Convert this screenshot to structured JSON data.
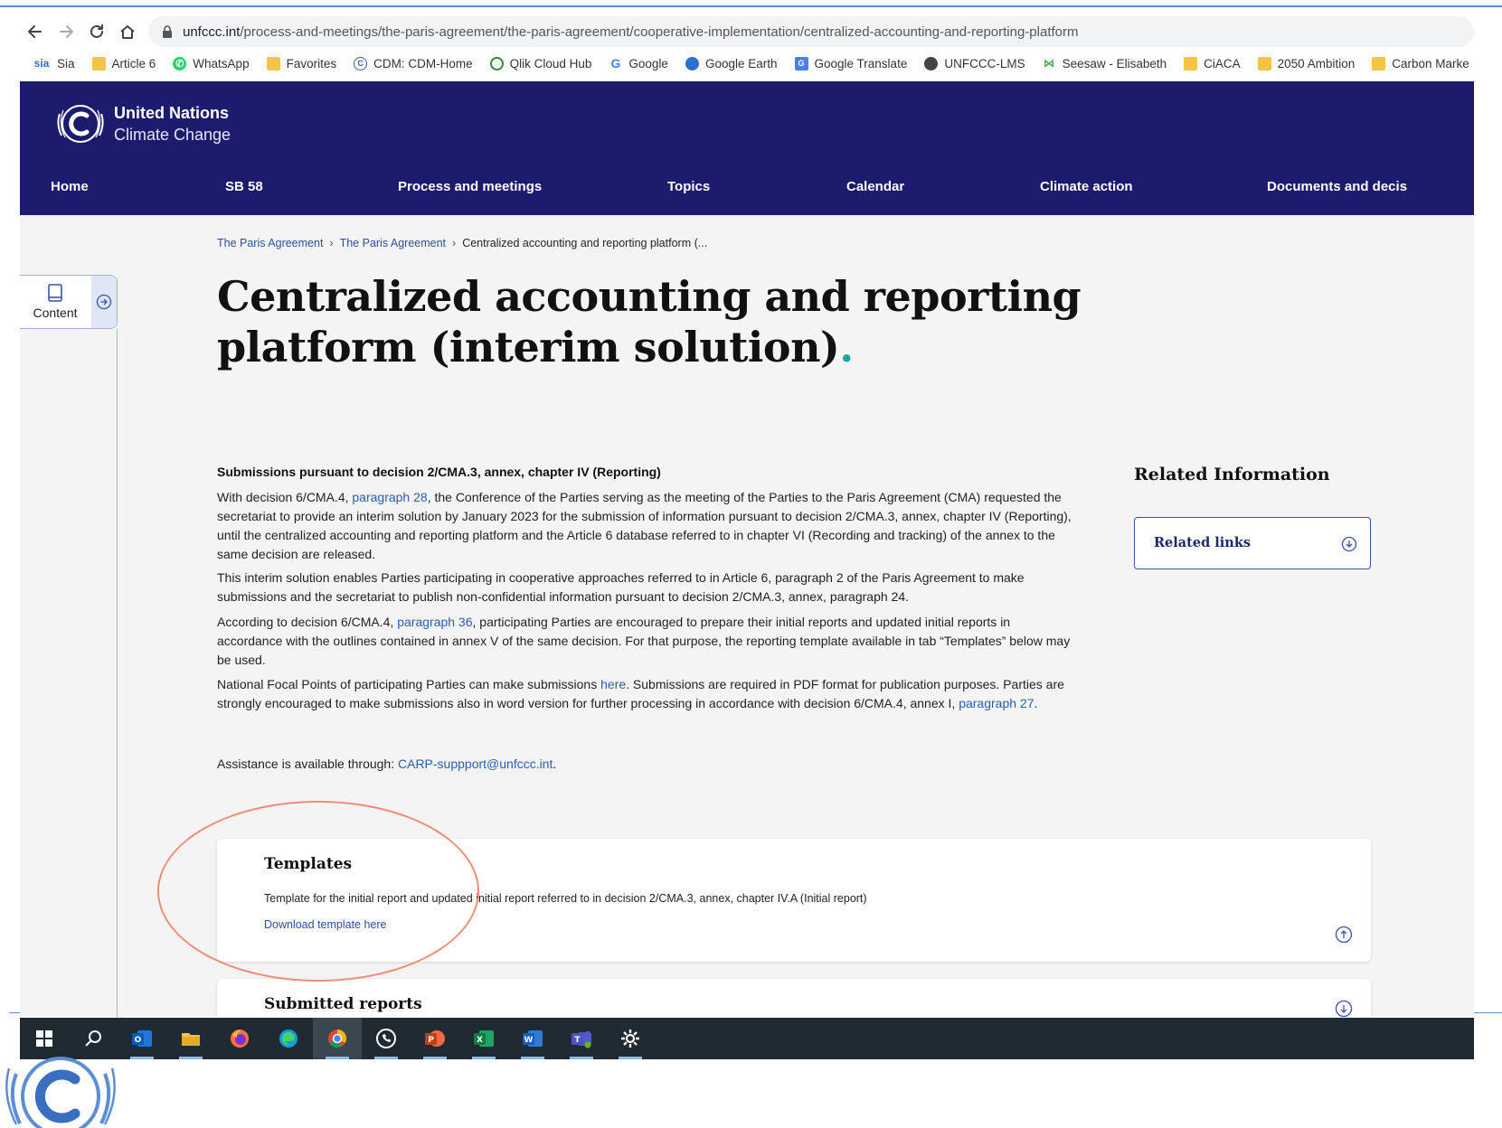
{
  "browser": {
    "url_host": "unfccc.int",
    "url_path": "/process-and-meetings/the-paris-agreement/the-paris-agreement/cooperative-implementation/centralized-accounting-and-reporting-platform",
    "bookmarks": [
      {
        "label": "Sia",
        "icon": "sia-icon"
      },
      {
        "label": "Article 6",
        "icon": "folder-icon"
      },
      {
        "label": "WhatsApp",
        "icon": "whatsapp-icon"
      },
      {
        "label": "Favorites",
        "icon": "folder-icon"
      },
      {
        "label": "CDM: CDM-Home",
        "icon": "cdm-icon"
      },
      {
        "label": "Qlik Cloud Hub",
        "icon": "qlik-icon"
      },
      {
        "label": "Google",
        "icon": "google-icon"
      },
      {
        "label": "Google Earth",
        "icon": "google-earth-icon"
      },
      {
        "label": "Google Translate",
        "icon": "google-translate-icon"
      },
      {
        "label": "UNFCCC-LMS",
        "icon": "unfccc-lms-icon"
      },
      {
        "label": "Seesaw - Elisabeth",
        "icon": "seesaw-icon"
      },
      {
        "label": "CiACA",
        "icon": "folder-icon"
      },
      {
        "label": "2050 Ambition",
        "icon": "folder-icon"
      },
      {
        "label": "Carbon Marke",
        "icon": "folder-icon"
      }
    ]
  },
  "header": {
    "logo_line1": "United Nations",
    "logo_line2": "Climate Change",
    "nav": [
      "Home",
      "SB 58",
      "Process and meetings",
      "Topics",
      "Calendar",
      "Climate action",
      "Documents and decis"
    ]
  },
  "sidebar": {
    "content_label": "Content"
  },
  "breadcrumb": {
    "item1": "The Paris Agreement",
    "item2": "The Paris Agreement",
    "current": "Centralized accounting and reporting platform (..."
  },
  "main": {
    "title": "Centralized accounting and reporting platform (interim solution)",
    "title_dot": ".",
    "section_heading": "Submissions pursuant to decision 2/CMA.3, annex, chapter IV (Reporting)",
    "p1": {
      "a": "With decision 6/CMA.4, ",
      "link": "paragraph 28",
      "b": ", the Conference of the Parties serving as the meeting of the Parties to the Paris Agreement (CMA) requested the secretariat to provide an interim solution by January 2023 for the submission of information pursuant to decision 2/CMA.3, annex, chapter IV (Reporting), until the centralized accounting and reporting platform and the Article 6 database referred to in chapter VI (Recording and tracking) of the annex to the same decision are released."
    },
    "p2": "This interim solution enables Parties participating in cooperative approaches referred to in Article 6, paragraph 2 of the Paris Agreement to make submissions and the secretariat to publish non-confidential information pursuant to decision 2/CMA.3, annex, paragraph 24.",
    "p3": {
      "a": "According to decision 6/CMA.4, ",
      "link": "paragraph 36",
      "b": ", participating Parties are encouraged to prepare their initial reports and updated initial reports in accordance with the outlines contained in annex V of the same decision. For that purpose, the reporting template available in tab “Templates” below may be used."
    },
    "p4": {
      "a": "National Focal Points of participating Parties can make submissions ",
      "link1": "here",
      "b": ". Submissions are required in PDF format for publication purposes. Parties are strongly encouraged to make submissions also in word version for further processing in accordance with decision 6/CMA.4, annex I, ",
      "link2": "paragraph 27",
      "c": "."
    },
    "p5": {
      "a": "Assistance is available through: ",
      "link": "CARP-suppport@unfccc.int",
      "b": "."
    }
  },
  "related": {
    "title": "Related Information",
    "links_label": "Related links"
  },
  "templates_card": {
    "title": "Templates",
    "description": "Template for the initial report and updated initial report referred to in decision 2/CMA.3, annex, chapter IV.A (Initial report)",
    "download_link": "Download template here"
  },
  "submitted_card": {
    "title": "Submitted reports"
  },
  "taskbar": [
    "windows-start-icon",
    "search-icon",
    "outlook-icon",
    "file-explorer-icon",
    "firefox-icon",
    "edge-icon",
    "chrome-icon",
    "whatsapp-icon",
    "powerpoint-icon",
    "excel-icon",
    "word-icon",
    "teams-icon",
    "settings-icon"
  ],
  "colors": {
    "header_bg": "#1c1b6e",
    "link": "#2a5db0",
    "accent_dot": "#22a6a0",
    "annotation": "#ee8d78",
    "taskbar_bg": "#1f2a33"
  }
}
